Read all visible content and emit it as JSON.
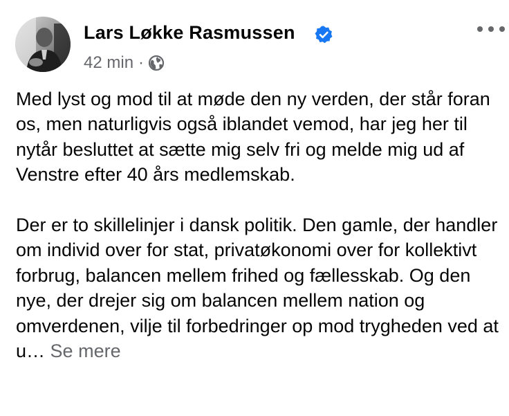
{
  "author": {
    "name": "Lars Løkke Rasmussen",
    "verified": true,
    "avatar_icon": "person-photo-icon"
  },
  "meta": {
    "time": "42 min",
    "separator": "·",
    "audience_icon": "globe-icon"
  },
  "more_icon": "more-horizontal-icon",
  "post": {
    "paragraph_1": "Med lyst og mod til at møde den ny verden, der står foran os, men naturligvis også iblandet vemod, har jeg her til nytår besluttet at sætte mig selv fri og melde mig ud af Venstre efter 40 års medlemskab.",
    "paragraph_2": "Der er to skillelinjer i dansk politik. Den gamle, der handler om individ over for stat, privatøkonomi over for kollektivt forbrug, balancen mellem frihed og fællesskab. Og den nye, der drejer sig om balancen mellem nation og omverdenen, vilje til forbedringer op mod trygheden ved at u…",
    "see_more": "Se mere"
  },
  "colors": {
    "text": "#050505",
    "secondary_text": "#65676b",
    "verified_blue": "#1877f2"
  }
}
